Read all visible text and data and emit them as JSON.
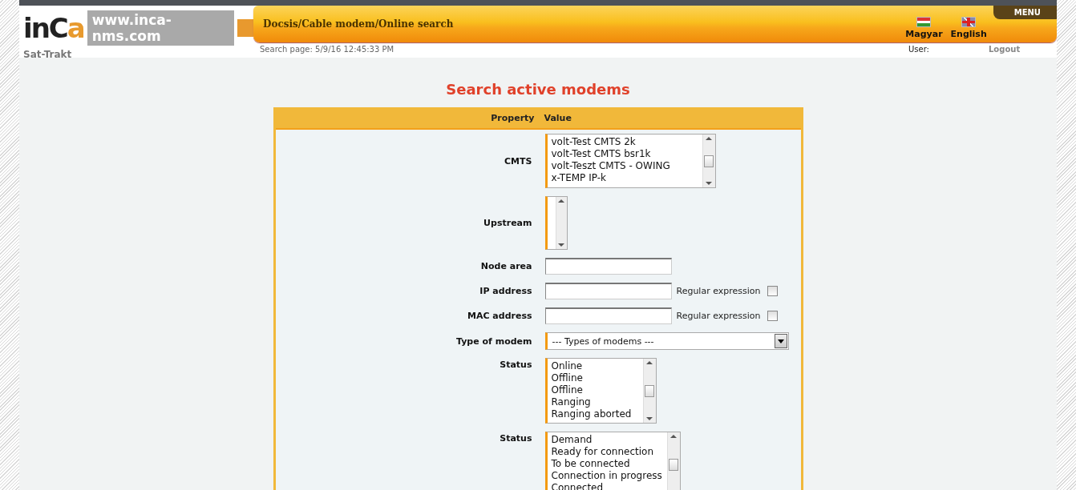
{
  "header": {
    "logo": "inCa",
    "url": "www.inca-nms.com",
    "subtitle": "Sat-Trakt",
    "breadcrumb": "Docsis/Cable modem/Online search",
    "search_time": "Search page: 5/9/16 12:45:33 PM",
    "languages": [
      {
        "label": "Magyar",
        "kind": "hungary"
      },
      {
        "label": "English",
        "kind": "uk"
      }
    ],
    "menu": "MENU",
    "user_label": "User:",
    "logout": "Logout"
  },
  "title": "Search active modems",
  "form": {
    "columns": [
      "Property",
      "Value"
    ],
    "rows": [
      {
        "label": "CMTS",
        "kind": "listbox",
        "items": [
          "volt-Test CMTS 2k",
          "volt-Test CMTS bsr1k",
          "volt-Teszt CMTS - OWING",
          "x-TEMP IP-k"
        ]
      },
      {
        "label": "Upstream",
        "kind": "listbox",
        "items": []
      },
      {
        "label": "Node area",
        "kind": "text"
      },
      {
        "label": "IP address",
        "kind": "regex",
        "regex_label": "Regular expression",
        "checked": false
      },
      {
        "label": "MAC address",
        "kind": "regex",
        "regex_label": "Regular expression",
        "checked": false
      },
      {
        "label": "Type of modem",
        "kind": "select",
        "value": "--- Types of modems ---"
      },
      {
        "label": "Status",
        "kind": "listbox",
        "items": [
          "Online",
          "Offline",
          "Offline",
          "Ranging",
          "Ranging aborted"
        ]
      },
      {
        "label": "Status",
        "kind": "listbox",
        "items": [
          "Demand",
          "Ready for connection",
          "To be connected",
          "Connection in progress",
          "Connected"
        ]
      }
    ]
  }
}
